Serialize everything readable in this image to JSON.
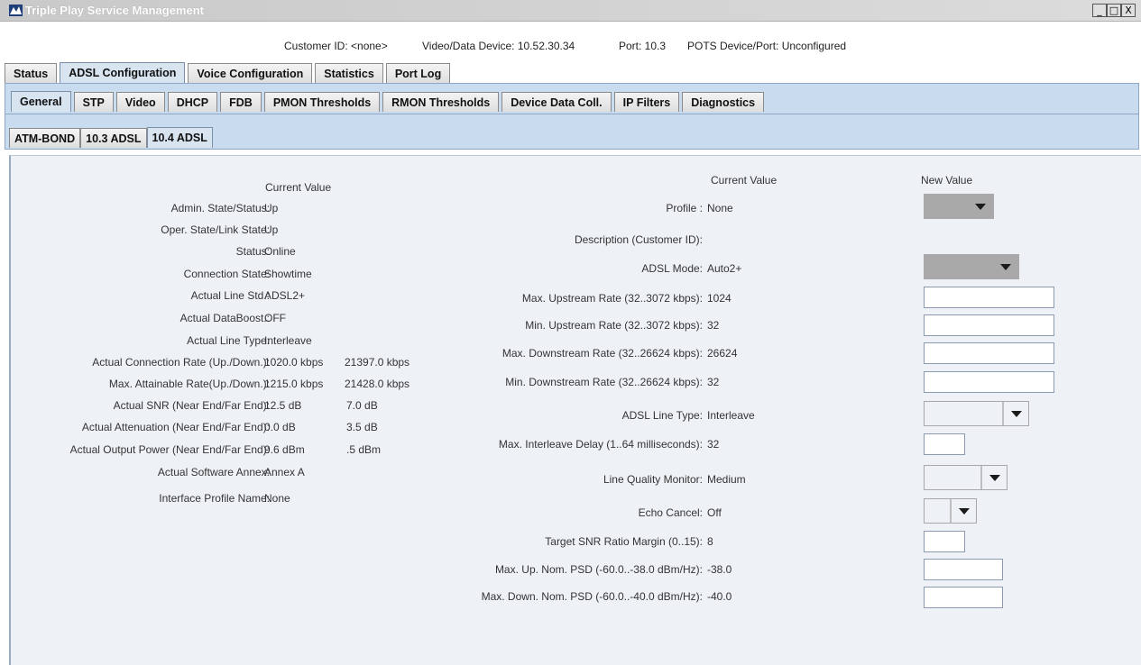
{
  "window": {
    "title": "Triple Play Service Management",
    "controls": [
      "_",
      "□",
      "X"
    ]
  },
  "info": {
    "customer_id": "Customer ID: <none>",
    "device": "Video/Data Device: 10.52.30.34",
    "port": "Port: 10.3",
    "pots": "POTS Device/Port: Unconfigured"
  },
  "tabs_level1": [
    "Status",
    "ADSL Configuration",
    "Voice Configuration",
    "Statistics",
    "Port Log"
  ],
  "tabs_level2": [
    "General",
    "STP",
    "Video",
    "DHCP",
    "FDB",
    "PMON Thresholds",
    "RMON Thresholds",
    "Device Data Coll.",
    "IP Filters",
    "Diagnostics"
  ],
  "tabs_level3": [
    "ATM-BOND",
    "10.3 ADSL",
    "10.4 ADSL"
  ],
  "left": {
    "header": "Current Value",
    "rows": [
      {
        "label": "Admin. State/Status:",
        "value": "Up",
        "value2": ""
      },
      {
        "label": "Oper. State/Link State:",
        "value": "Up",
        "value2": ""
      },
      {
        "label": "Status:",
        "value": "Online",
        "value2": ""
      },
      {
        "label": "Connection State:",
        "value": "Showtime",
        "value2": ""
      },
      {
        "label": "Actual Line Std.:",
        "value": "ADSL2+",
        "value2": ""
      },
      {
        "label": "Actual DataBoost.:",
        "value": "OFF",
        "value2": ""
      },
      {
        "label": "Actual Line Type:",
        "value": "Interleave",
        "value2": ""
      },
      {
        "label": "Actual Connection Rate (Up./Down.):",
        "value": "1020.0 kbps",
        "value2": "21397.0 kbps"
      },
      {
        "label": "Max. Attainable Rate(Up./Down.):",
        "value": "1215.0 kbps",
        "value2": "21428.0 kbps"
      },
      {
        "label": "Actual SNR (Near End/Far End):",
        "value": "12.5 dB",
        "value2": "7.0 dB"
      },
      {
        "label": "Actual Attenuation (Near End/Far End):",
        "value": "0.0 dB",
        "value2": "3.5 dB"
      },
      {
        "label": "Actual Output Power (Near End/Far End):",
        "value": "9.6 dBm",
        "value2": ".5 dBm"
      },
      {
        "label": "Actual Software Annex:",
        "value": "Annex A",
        "value2": ""
      },
      {
        "label": "Interface Profile Name:",
        "value": "None",
        "value2": ""
      }
    ]
  },
  "right": {
    "header_current": "Current Value",
    "header_new": "New Value",
    "rows": [
      {
        "label": "Profile :",
        "value": "None"
      },
      {
        "label": "Description (Customer ID):",
        "value": ""
      },
      {
        "label": "ADSL Mode:",
        "value": "Auto2+"
      },
      {
        "label": "Max. Upstream Rate (32..3072 kbps):",
        "value": "1024"
      },
      {
        "label": "Min. Upstream Rate (32..3072 kbps):",
        "value": "32"
      },
      {
        "label": "Max. Downstream Rate (32..26624 kbps):",
        "value": "26624"
      },
      {
        "label": "Min. Downstream Rate (32..26624 kbps):",
        "value": "32"
      },
      {
        "label": "ADSL Line Type:",
        "value": "Interleave"
      },
      {
        "label": "Max. Interleave Delay (1..64 milliseconds):",
        "value": "32"
      },
      {
        "label": "Line Quality Monitor:",
        "value": "Medium"
      },
      {
        "label": "Echo Cancel:",
        "value": "Off"
      },
      {
        "label": "Target SNR Ratio Margin (0..15):",
        "value": "8"
      },
      {
        "label": "Max. Up. Nom. PSD (-60.0..-38.0 dBm/Hz):",
        "value": "-38.0"
      },
      {
        "label": "Max. Down. Nom. PSD (-60.0..-40.0 dBm/Hz):",
        "value": "-40.0"
      }
    ]
  }
}
